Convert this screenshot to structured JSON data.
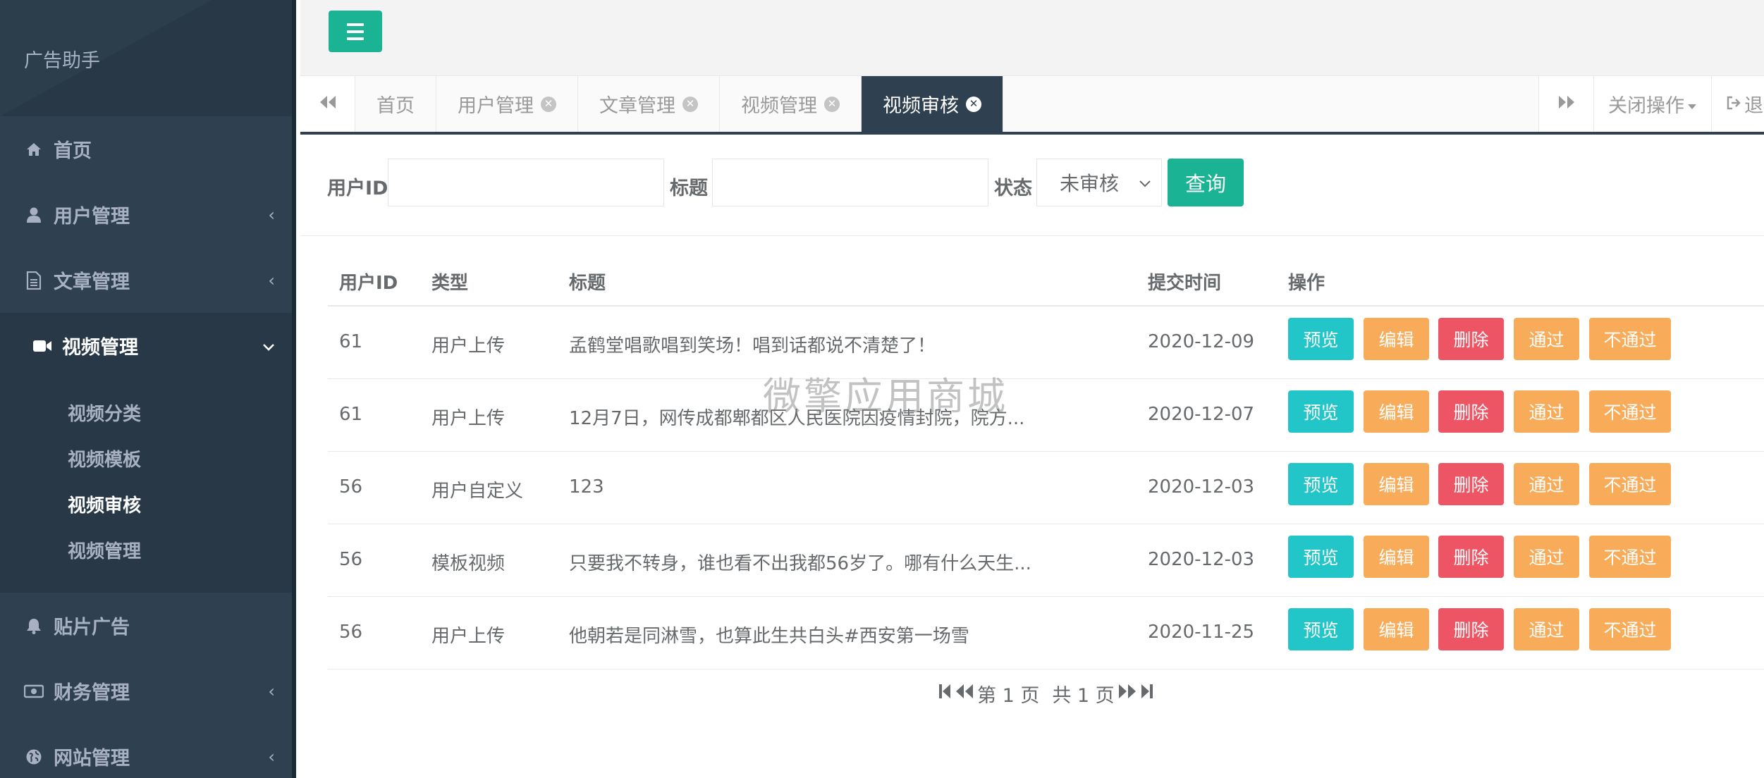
{
  "app": {
    "brand": "广告助手"
  },
  "colors": {
    "sidebar": "#2f4050",
    "primary": "#1ab394",
    "info": "#23c6c8",
    "warning": "#f8ac59",
    "danger": "#ed5565"
  },
  "sidebar": {
    "items": [
      {
        "label": "首页",
        "icon": "home-icon"
      },
      {
        "label": "用户管理",
        "icon": "user-icon"
      },
      {
        "label": "文章管理",
        "icon": "file-icon"
      },
      {
        "label": "视频管理",
        "icon": "video-icon"
      },
      {
        "label": "贴片广告",
        "icon": "bell-icon"
      },
      {
        "label": "财务管理",
        "icon": "money-icon"
      },
      {
        "label": "网站管理",
        "icon": "globe-icon"
      }
    ],
    "submenu": [
      "视频分类",
      "视频模板",
      "视频审核",
      "视频管理"
    ]
  },
  "tabs": [
    {
      "label": "首页"
    },
    {
      "label": "用户管理"
    },
    {
      "label": "文章管理"
    },
    {
      "label": "视频管理"
    },
    {
      "label": "视频审核"
    }
  ],
  "tabbar": {
    "close_ops": "关闭操作",
    "logout": "退出"
  },
  "search": {
    "userid_label": "用户ID",
    "title_label": "标题",
    "status_label": "状态",
    "status_value": "未审核",
    "query_button": "查询"
  },
  "table": {
    "headers": [
      "用户ID",
      "类型",
      "标题",
      "提交时间",
      "操作"
    ],
    "rows": [
      {
        "uid": "61",
        "type": "用户上传",
        "title": "孟鹤堂唱歌唱到笑场！唱到话都说不清楚了！",
        "time": "2020-12-09"
      },
      {
        "uid": "61",
        "type": "用户上传",
        "title": "12月7日，网传成都郫都区人民医院因疫情封院，院方...",
        "time": "2020-12-07"
      },
      {
        "uid": "56",
        "type": "用户自定义",
        "title": "123",
        "time": "2020-12-03"
      },
      {
        "uid": "56",
        "type": "模板视频",
        "title": "只要我不转身，谁也看不出我都56岁了。哪有什么天生...",
        "time": "2020-12-03"
      },
      {
        "uid": "56",
        "type": "用户上传",
        "title": "他朝若是同淋雪，也算此生共白头#西安第一场雪",
        "time": "2020-11-25"
      }
    ],
    "actions": {
      "preview": "预览",
      "edit": "编辑",
      "delete": "删除",
      "pass": "通过",
      "fail": "不通过"
    }
  },
  "pager": {
    "page": "第 1 页",
    "total": "共 1 页"
  },
  "watermark": "微擎应用商城"
}
